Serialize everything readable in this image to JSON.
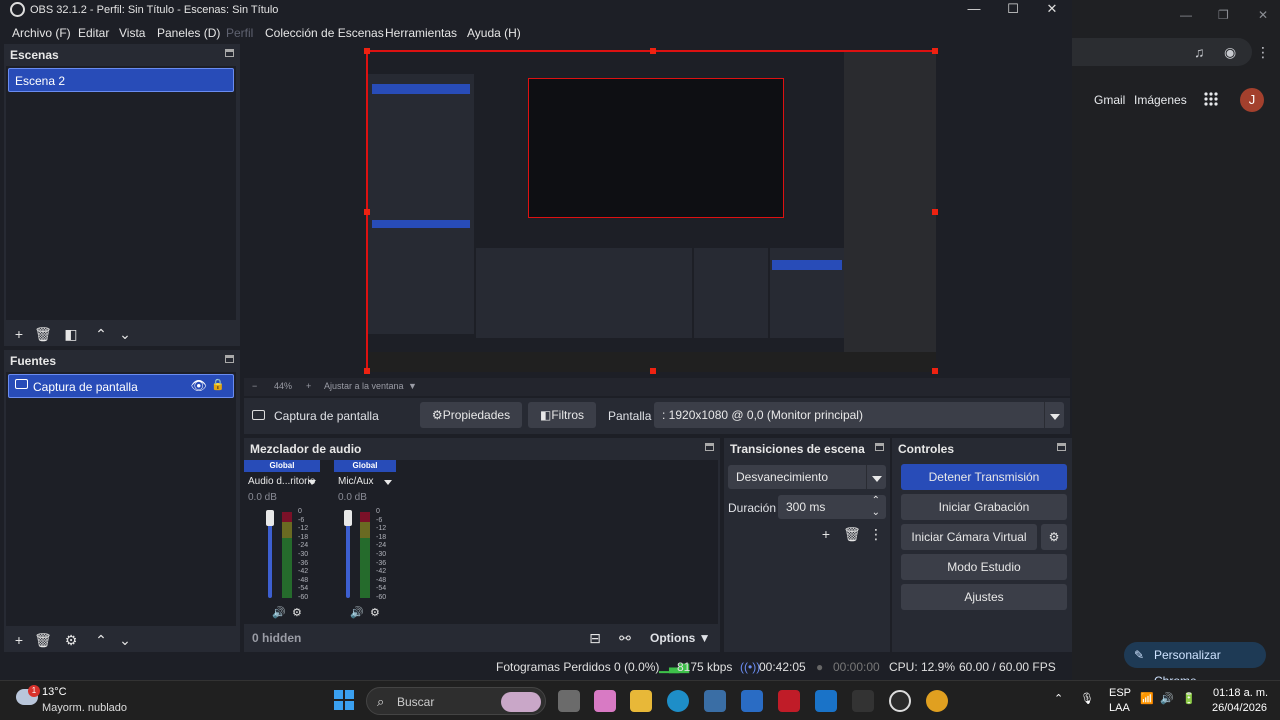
{
  "window": {
    "title": "OBS 32.1.2 - Perfil: Sin Título - Escenas: Sin Título"
  },
  "menu": [
    "Archivo (F)",
    "Editar",
    "Vista",
    "Paneles (D)",
    "Perfil",
    "Colección de Escenas",
    "Herramientas",
    "Ayuda (H)"
  ],
  "scenes": {
    "title": "Escenas",
    "items": [
      "Escena 2"
    ]
  },
  "sources": {
    "title": "Fuentes",
    "items": [
      "Captura de pantalla"
    ]
  },
  "preview": {
    "zoom": "44%",
    "fit_label": "Ajustar a la ventana"
  },
  "source_bar": {
    "selected_source": "Captura de pantalla",
    "properties_label": "Propiedades",
    "filters_label": "Filtros",
    "display_label": "Pantalla",
    "display_value": ": 1920x1080 @ 0,0 (Monitor principal)"
  },
  "mixer": {
    "title": "Mezclador de audio",
    "channels": [
      {
        "group": "Global",
        "name": "Audio d...ritorio",
        "db": "0.0 dB"
      },
      {
        "group": "Global",
        "name": "Mic/Aux",
        "db": "0.0 dB"
      }
    ],
    "scale": [
      "0",
      "-6",
      "-12",
      "-18",
      "-24",
      "-30",
      "-36",
      "-42",
      "-48",
      "-54",
      "-60"
    ],
    "hidden_label": "0 hidden",
    "options_label": "Options"
  },
  "transitions": {
    "title": "Transiciones de escena",
    "selected": "Desvanecimiento",
    "duration_label": "Duración",
    "duration_value": "300 ms"
  },
  "controls": {
    "title": "Controles",
    "stop_stream": "Detener Transmisión",
    "start_recording": "Iniciar Grabación",
    "start_virtual_cam": "Iniciar Cámara Virtual",
    "studio_mode": "Modo Estudio",
    "settings": "Ajustes"
  },
  "status": {
    "dropped_frames": "Fotogramas Perdidos 0 (0.0%)",
    "bitrate": "8175 kbps",
    "stream_time": "00:42:05",
    "rec_time": "00:00:00",
    "cpu": "CPU: 12.9%",
    "fps": "60.00 / 60.00 FPS"
  },
  "chrome": {
    "gmail": "Gmail",
    "images": "Imágenes",
    "avatar_letter": "J",
    "customize": "Personalizar Chrome"
  },
  "taskbar": {
    "temperature": "13°C",
    "condition": "Mayorm. nublado",
    "weather_badge": "1",
    "search_placeholder": "Buscar",
    "lang_top": "ESP",
    "lang_bottom": "LAA",
    "time": "01:18 a. m.",
    "date": "26/04/2026"
  },
  "colors": {
    "accent": "#284cb8",
    "bg": "#1d1f26",
    "panel": "#272a33",
    "preview_border": "#dd1111"
  }
}
